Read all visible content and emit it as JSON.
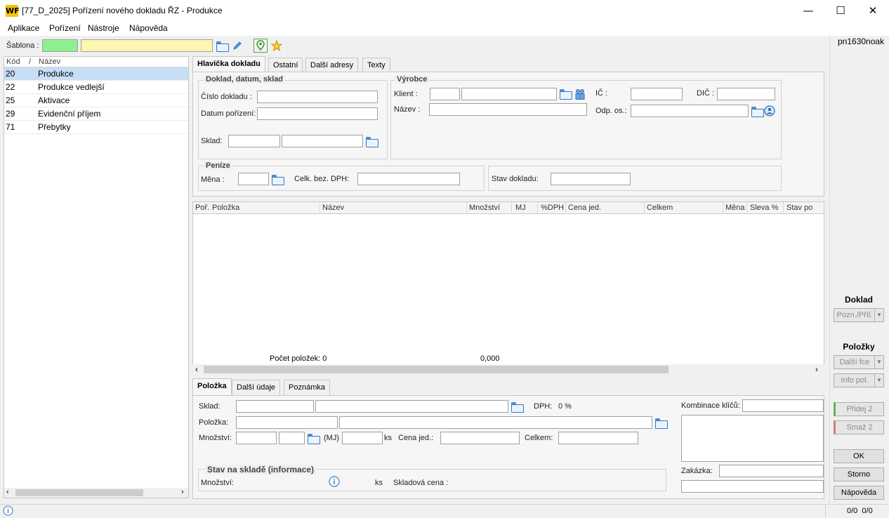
{
  "window": {
    "title": "[77_D_2025] Pořízení nového dokladu ŘZ - Produkce",
    "logo": "WF",
    "minimize": "—",
    "maximize": "☐",
    "close": "✕"
  },
  "menu": [
    "Aplikace",
    "Pořízení",
    "Nástroje",
    "Nápověda"
  ],
  "toolbar": {
    "sablona_label": "Šablona :"
  },
  "user": "pn1630noak",
  "left_list": {
    "headers": {
      "kod": "Kód",
      "sort": "/",
      "nazev": "Název"
    },
    "rows": [
      {
        "kod": "20",
        "nazev": "Produkce"
      },
      {
        "kod": "22",
        "nazev": "Produkce vedlejší"
      },
      {
        "kod": "25",
        "nazev": "Aktivace"
      },
      {
        "kod": "29",
        "nazev": "Evidenční příjem"
      },
      {
        "kod": "71",
        "nazev": "Přebytky"
      }
    ]
  },
  "top_tabs": [
    "Hlavička dokladu",
    "Ostatní",
    "Další adresy",
    "Texty"
  ],
  "doklad_group": {
    "title": "Doklad, datum, sklad",
    "cislo": "Číslo dokladu :",
    "datum": "Datum pořízení:",
    "sklad": "Sklad:"
  },
  "vyrobce_group": {
    "title": "Výrobce",
    "klient": "Klient :",
    "nazev": "Název :",
    "ic": "IČ :",
    "dic": "DIČ :",
    "odp": "Odp. os.:"
  },
  "penize_group": {
    "title": "Peníze",
    "mena": "Měna :",
    "celk": "Celk. bez. DPH:",
    "stav": "Stav dokladu:"
  },
  "grid": {
    "columns": [
      "Poř.",
      "Položka",
      "Název",
      "Množství",
      "MJ",
      "%DPH",
      "Cena jed.",
      "Celkem",
      "Měna",
      "Sleva %",
      "Stav po"
    ],
    "footer_count": "Počet položek: 0",
    "footer_sum": "0,000"
  },
  "bottom_tabs": [
    "Položka",
    "Další údaje",
    "Poznámka"
  ],
  "polozka_form": {
    "sklad": "Sklad:",
    "dph_label": "DPH:",
    "dph_value": "0 %",
    "polozka": "Položka:",
    "mnozstvi": "Množství:",
    "mj": "(MJ)",
    "ks": "ks",
    "cena": "Cena jed.:",
    "celkem": "Celkem:",
    "kombinace": "Kombinace klíčů:",
    "zakazka": "Zakázka:"
  },
  "stav_group": {
    "title": "Stav na skladě (informace)",
    "mnozstvi": "Množství:",
    "ks": "ks",
    "cena": "Skladová cena :"
  },
  "right_panel": {
    "doklad_head": "Doklad",
    "pozn": "Pozn./Příl.",
    "polozky_head": "Položky",
    "dalsi": "Další fce",
    "info": "Info pol.",
    "pridej": "Přidej 2",
    "smaz": "Smaž 2",
    "ok": "OK",
    "storno": "Storno",
    "napoveda": "Nápověda"
  },
  "statusbar": {
    "counts": "0/0  0/0"
  }
}
